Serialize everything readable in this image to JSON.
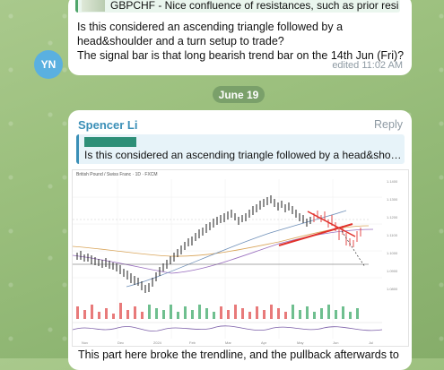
{
  "first_message": {
    "quote_text": "GBPCHF - Nice confluence of resistances, such as prior resi…",
    "line1": "Is this considered an ascending triangle followed by a",
    "line2": "head&shoulder and a turn setup to trade?",
    "line3": "The signal bar is that long bearish trend bar on the 14th Jun (Fri)?",
    "edited": "edited 11:02 AM",
    "avatar_initials": "YN"
  },
  "date_separator": "June 19",
  "second_message": {
    "sender": "Spencer Li",
    "reply_label": "Reply",
    "quote_text": "Is this considered an ascending triangle followed by a head&sho…",
    "chart_title": "British Pound / Swiss Franc · 1D · FXCM",
    "body": "This part here broke the trendline, and the pullback afterwards to"
  },
  "colors": {
    "accent_blue": "#3a8fb7",
    "candle_up": "#1f1f1f",
    "candle_down": "#e64b4b",
    "trendline": "#e0302a"
  }
}
